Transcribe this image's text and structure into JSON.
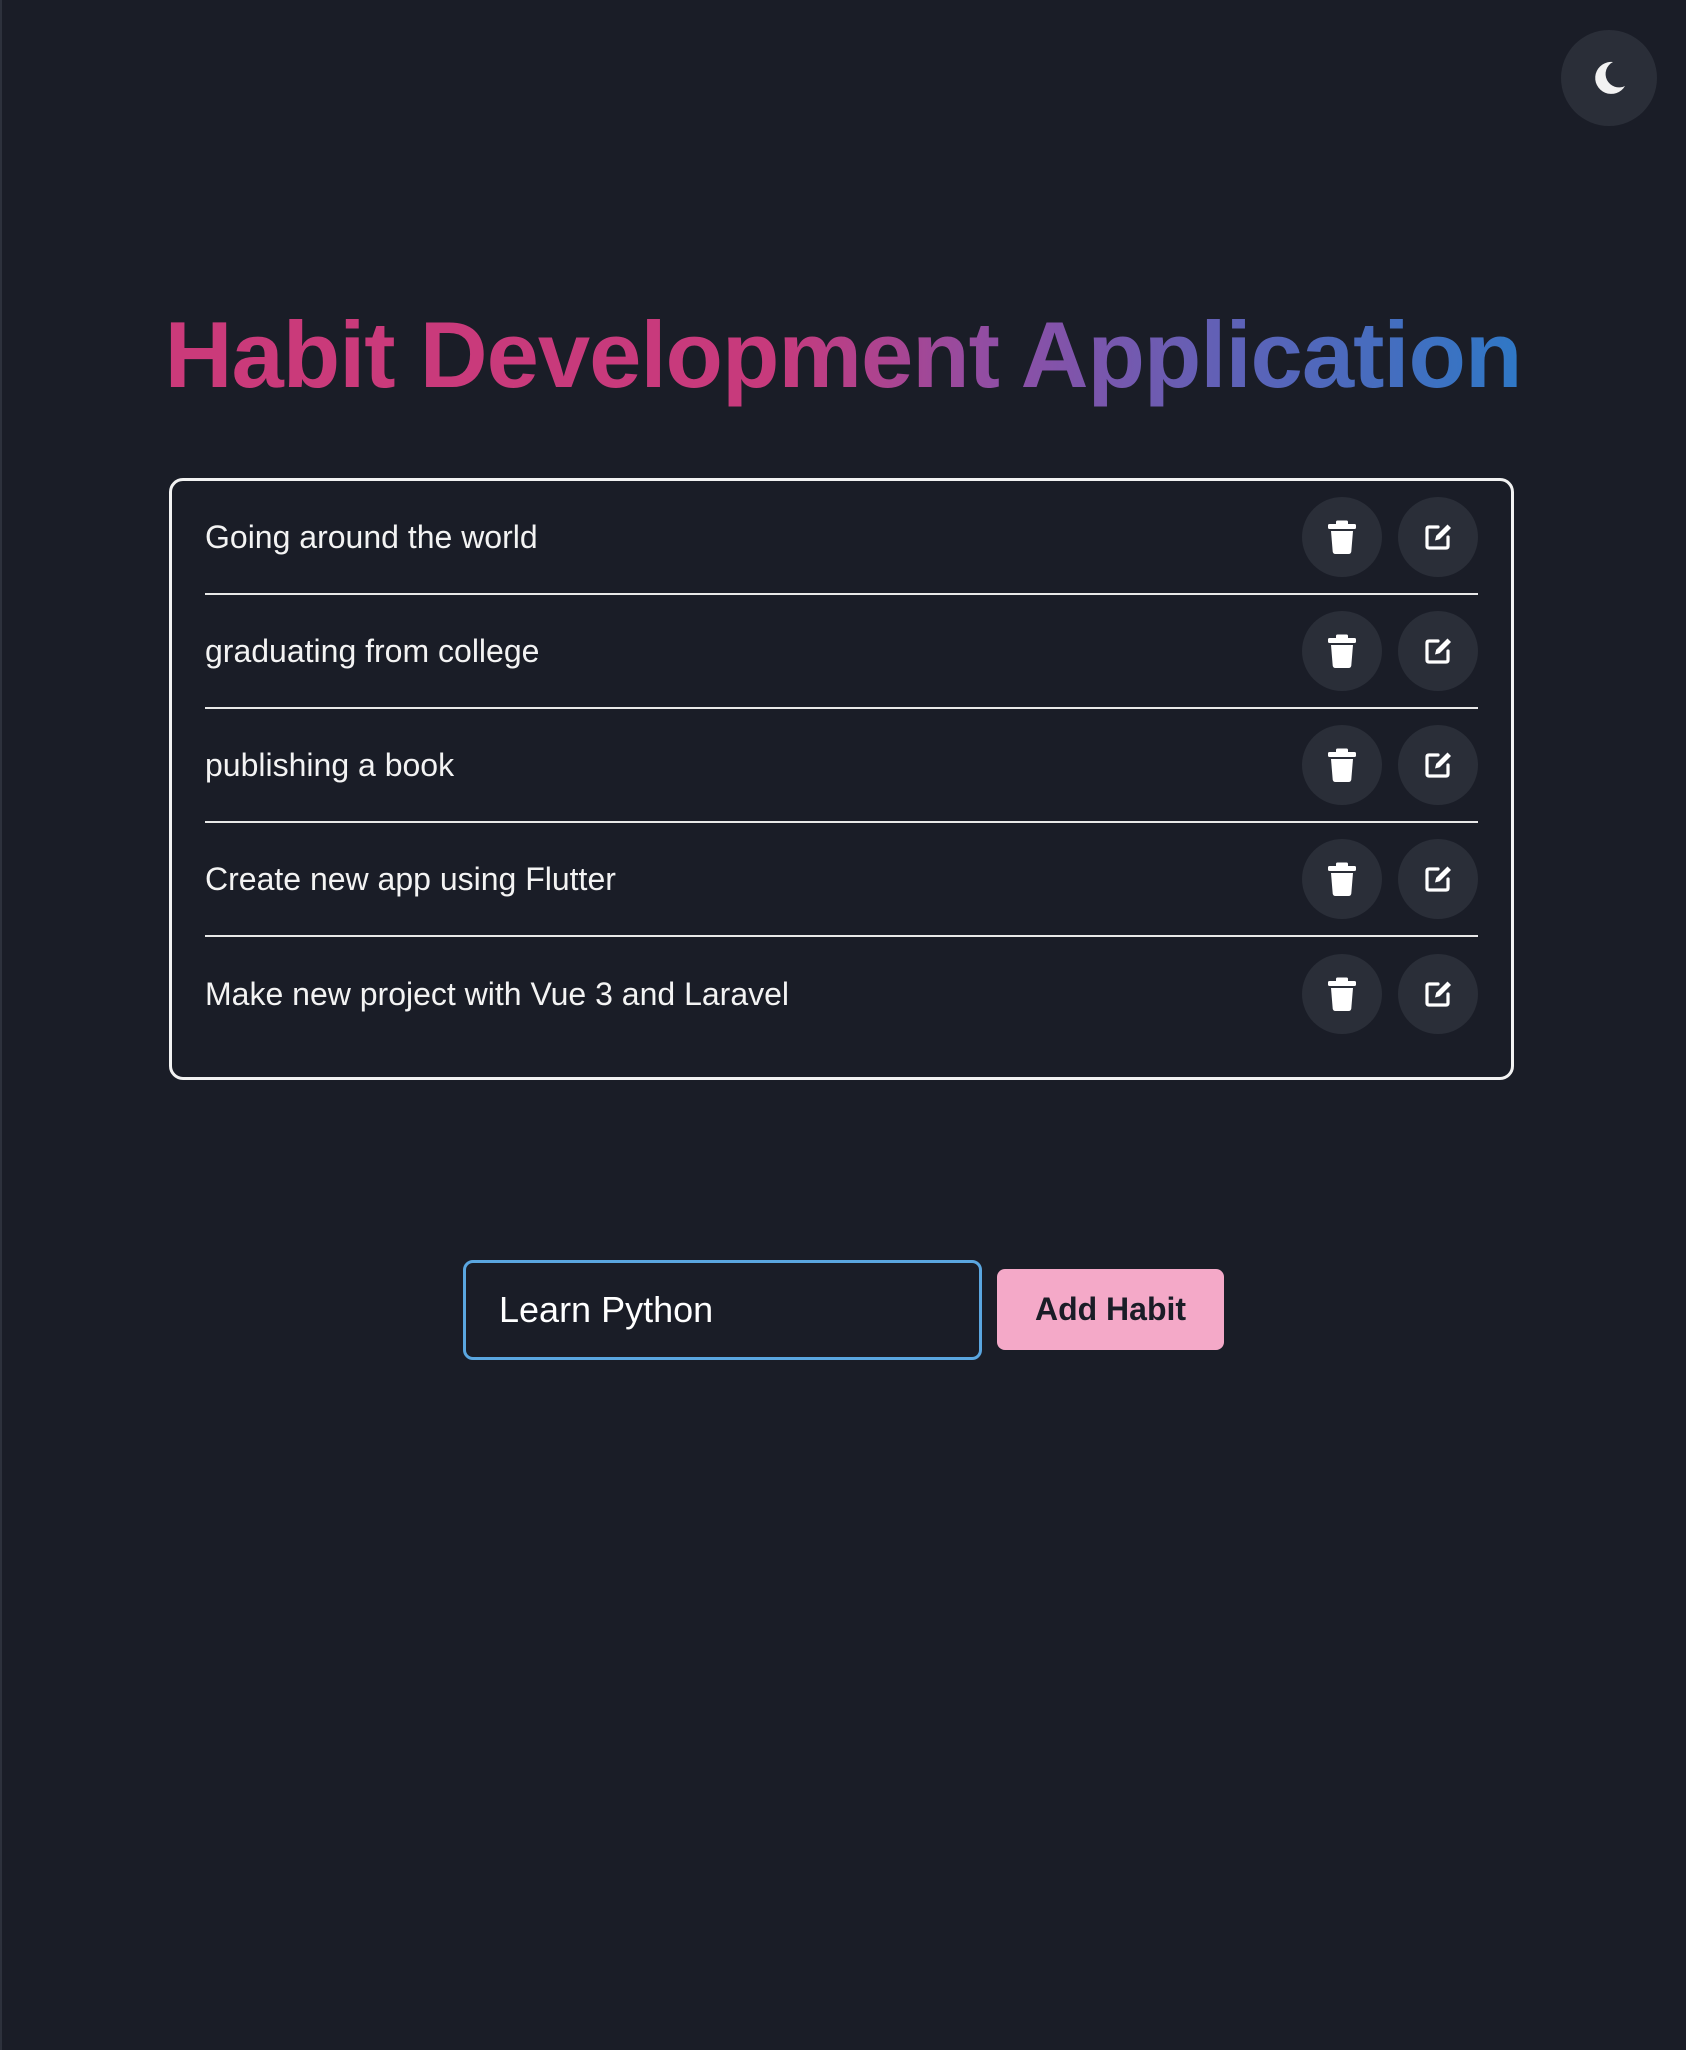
{
  "theme_toggle": {
    "icon": "moon-icon"
  },
  "header": {
    "title": "Habit Development Application"
  },
  "colors": {
    "background": "#1a1d27",
    "title_gradient_start": "#cb3a7a",
    "title_gradient_mid": "#8d4fa6",
    "title_gradient_end": "#2f78c6",
    "icon_button_bg": "#2a2e38",
    "input_focus_border": "#5aa6e0",
    "add_button_bg": "#f4a9c8"
  },
  "habits": {
    "items": [
      {
        "text": "Going around the world",
        "delete_icon": "trash-icon",
        "edit_icon": "edit-icon"
      },
      {
        "text": "graduating from college",
        "delete_icon": "trash-icon",
        "edit_icon": "edit-icon"
      },
      {
        "text": "publishing a book",
        "delete_icon": "trash-icon",
        "edit_icon": "edit-icon"
      },
      {
        "text": "Create new app using Flutter",
        "delete_icon": "trash-icon",
        "edit_icon": "edit-icon"
      },
      {
        "text": "Make new project with Vue 3 and Laravel",
        "delete_icon": "trash-icon",
        "edit_icon": "edit-icon"
      }
    ]
  },
  "add_form": {
    "input_value": "Learn Python",
    "button_label": "Add Habit"
  }
}
